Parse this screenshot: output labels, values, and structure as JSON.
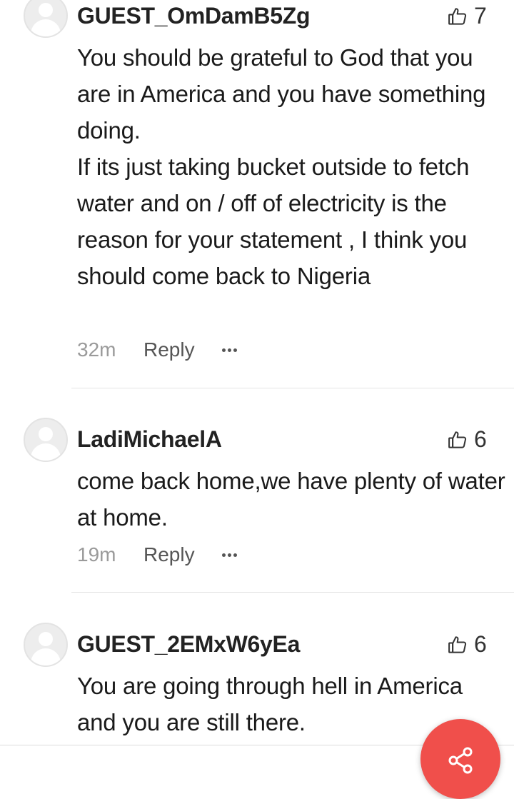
{
  "comments": [
    {
      "username": "GUEST_OmDamB5Zg",
      "likes": "7",
      "paragraphs": [
        "You should be grateful to God that you are in America and you have something doing.",
        "If its just taking bucket outside to fetch water and on / off of electricity is the reason for your statement , I think you should come back to Nigeria"
      ],
      "time": "32m",
      "reply_label": "Reply"
    },
    {
      "username": "LadiMichaelA",
      "likes": "6",
      "paragraphs": [
        "come back home,we have plenty of water at home."
      ],
      "time": "19m",
      "reply_label": "Reply"
    },
    {
      "username": "GUEST_2EMxW6yEa",
      "likes": "6",
      "paragraphs": [
        "You are going through hell in America and you are still there."
      ]
    }
  ],
  "icons": {
    "like": "thumbs-up-outline-icon",
    "more": "ellipsis-icon",
    "share": "share-icon"
  },
  "colors": {
    "fab": "#f04f4b",
    "time": "#9a9a9a",
    "text": "#1a1a1a"
  }
}
